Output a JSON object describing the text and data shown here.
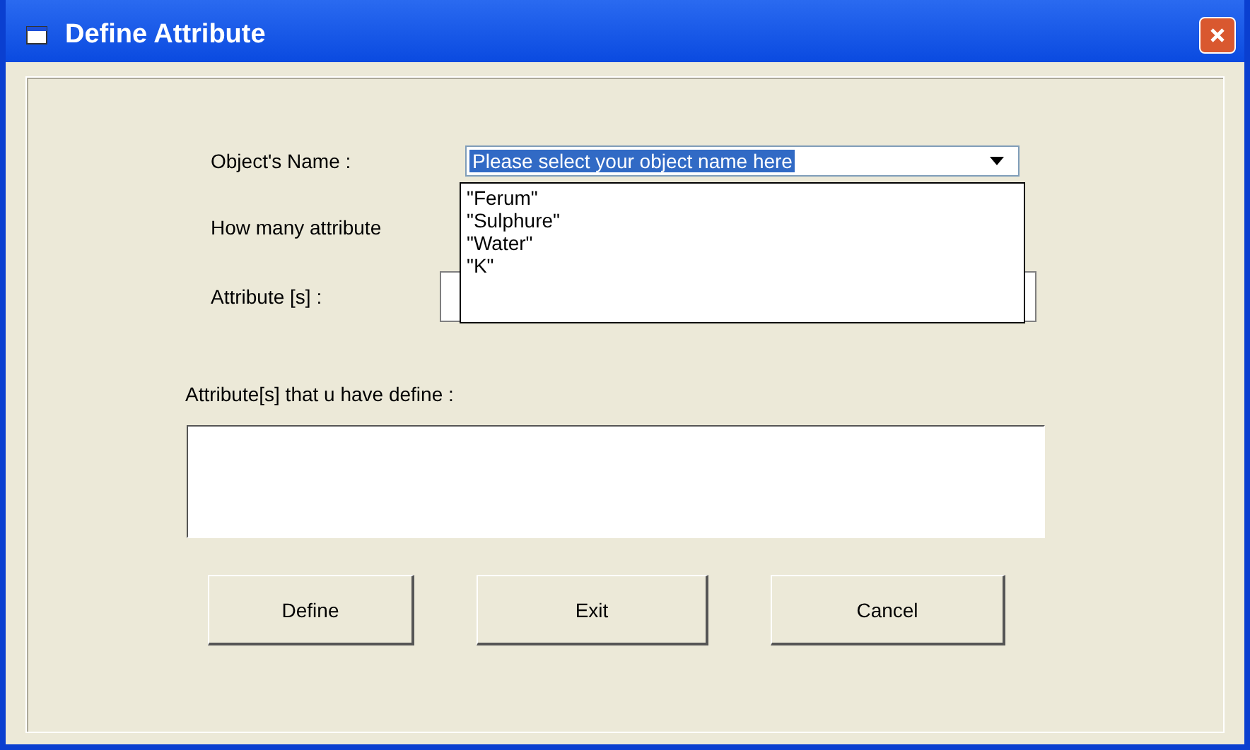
{
  "window": {
    "title": "Define Attribute"
  },
  "object_name": {
    "label": "Object's Name :",
    "value": "Please select your object name here",
    "expanded": true,
    "options": [
      "\"Ferum\"",
      "\"Sulphure\"",
      "\"Water\"",
      "\"K\""
    ]
  },
  "count_label": "How many attribute",
  "attribute": {
    "label": "Attribute [s] :"
  },
  "defined": {
    "label": "Attribute[s] that u have define :"
  },
  "buttons": [
    "Define",
    "Exit",
    "Cancel"
  ]
}
